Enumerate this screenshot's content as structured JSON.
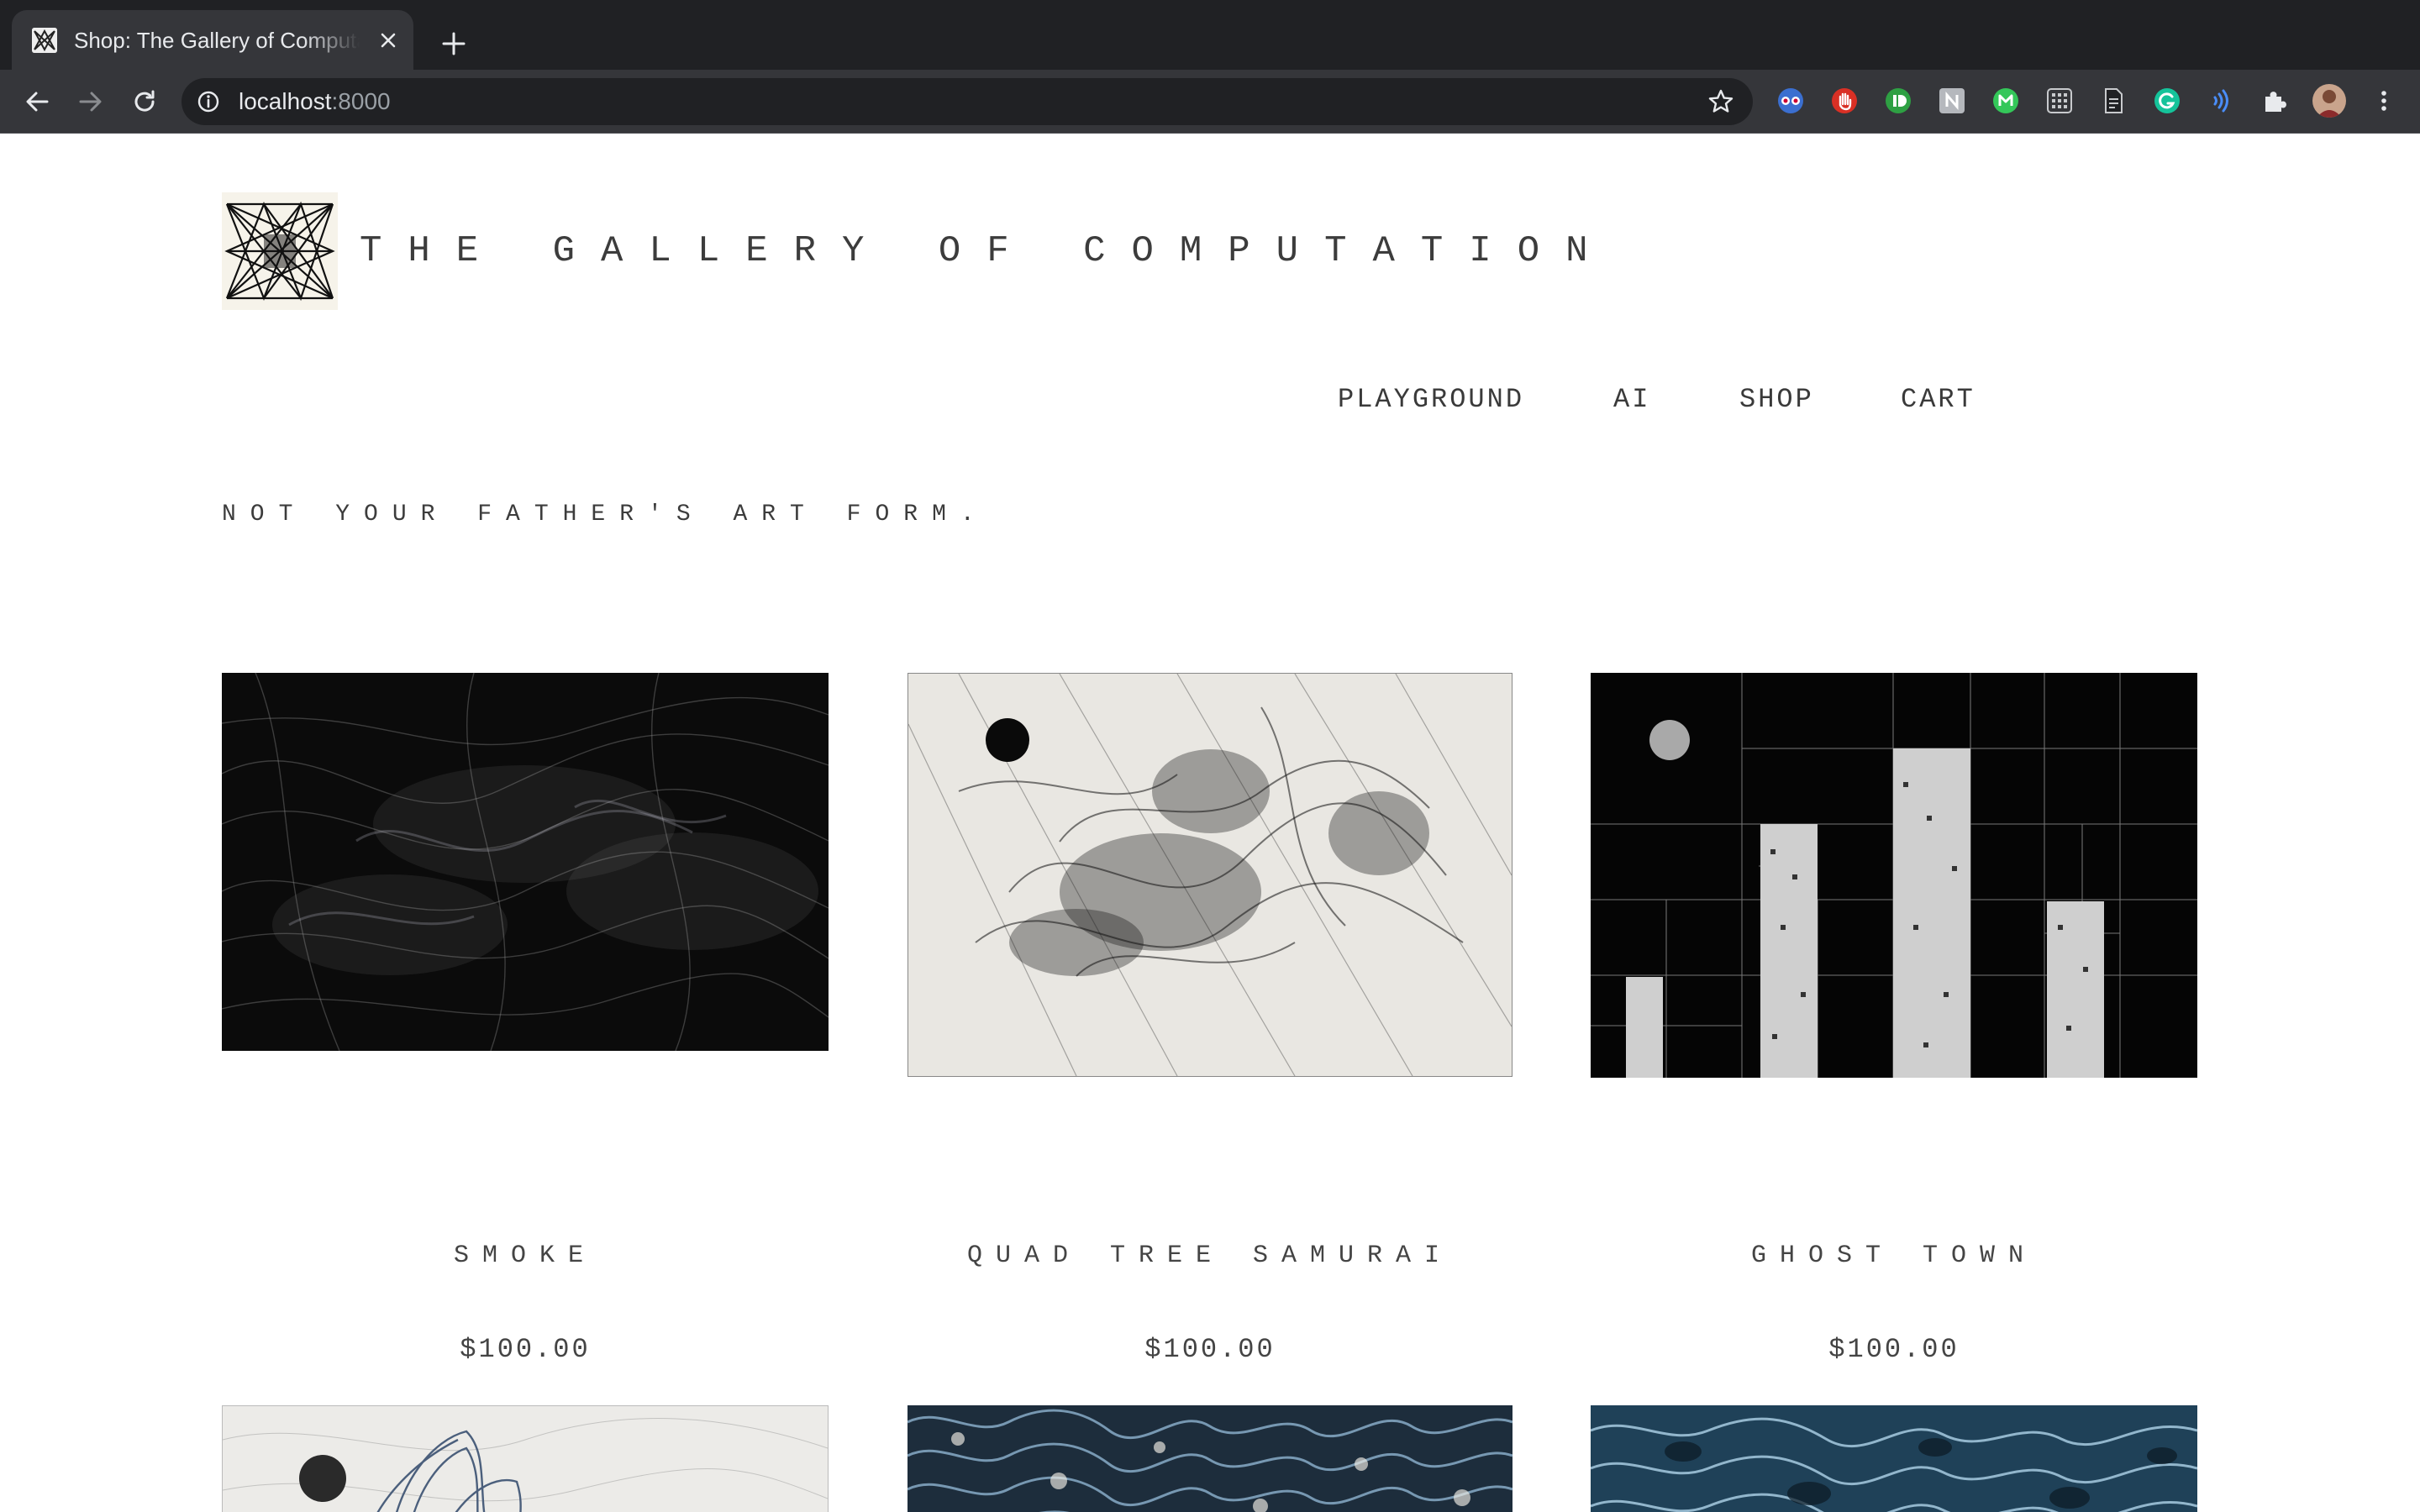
{
  "browser": {
    "tab_title": "Shop: The Gallery of Computation",
    "url_host": "localhost",
    "url_port": ":8000",
    "extensions": [
      "spectacles-icon",
      "stop-hand-icon",
      "instapaper-icon",
      "notes-icon",
      "mercury-icon",
      "grid-app-icon",
      "document-icon",
      "grammarly-icon",
      "audio-waves-icon",
      "puzzle-extensions-icon"
    ],
    "profile_icon": "profile-avatar"
  },
  "site": {
    "title": "THE GALLERY OF COMPUTATION",
    "nav": [
      "PLAYGROUND",
      "AI",
      "SHOP",
      "CART"
    ],
    "tagline": "NOT YOUR FATHER'S ART FORM."
  },
  "products": [
    {
      "title": "SMOKE",
      "price": "$100.00"
    },
    {
      "title": "QUAD TREE SAMURAI",
      "price": "$100.00"
    },
    {
      "title": "GHOST TOWN",
      "price": "$100.00"
    }
  ],
  "colors": {
    "chrome_dark": "#202124",
    "chrome_toolbar": "#35363a",
    "page_text": "#3c3c3c",
    "page_bg": "#ffffff"
  }
}
